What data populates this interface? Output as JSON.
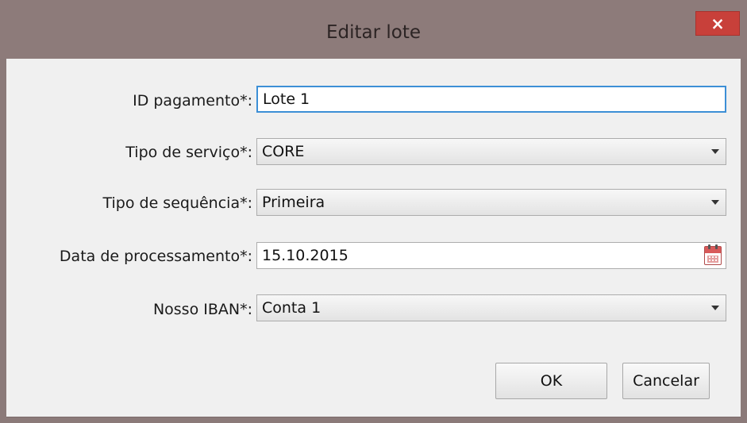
{
  "window": {
    "title": "Editar lote",
    "close_label": "×"
  },
  "form": {
    "fields": [
      {
        "label": "ID pagamento*:",
        "value": "Lote 1",
        "kind": "text"
      },
      {
        "label": "Tipo de serviço*:",
        "value": "CORE",
        "kind": "combo"
      },
      {
        "label": "Tipo de sequência*:",
        "value": "Primeira",
        "kind": "combo"
      },
      {
        "label": "Data de processamento*:",
        "value": "15.10.2015",
        "kind": "date"
      },
      {
        "label": "Nosso IBAN*:",
        "value": "Conta 1",
        "kind": "combo"
      }
    ]
  },
  "buttons": {
    "ok_label": "OK",
    "cancel_label": "Cancelar"
  },
  "icons": {
    "close": "close-icon",
    "dropdown": "chevron-down-icon",
    "date": "calendar-icon"
  },
  "colors": {
    "titlebar": "#8d7b7a",
    "close_button": "#c8403a",
    "focus_border": "#3c8fd6",
    "dialog_background": "#f0f0f0"
  }
}
